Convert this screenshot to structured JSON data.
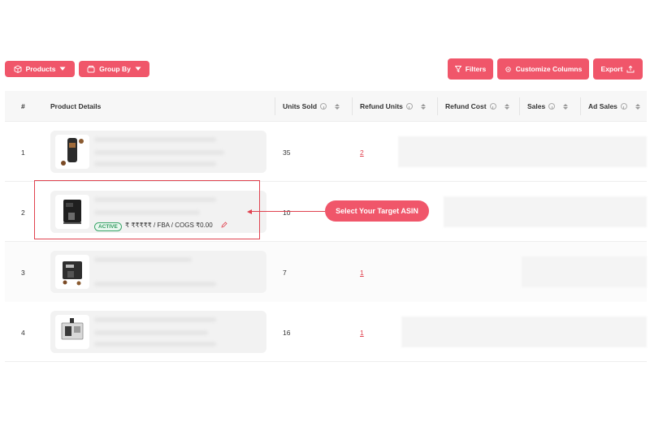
{
  "toolbar": {
    "products_label": "Products",
    "groupby_label": "Group By",
    "filters_label": "Filters",
    "customize_label": "Customize Columns",
    "export_label": "Export"
  },
  "table": {
    "headers": [
      "#",
      "Product Details",
      "Units Sold",
      "Refund Units",
      "Refund Cost",
      "Sales",
      "Ad Sales"
    ],
    "rows": [
      {
        "index": "1",
        "units_sold": "35",
        "refund_units": "2"
      },
      {
        "index": "2",
        "units_sold": "10",
        "refund_units": "",
        "status": "ACTIVE",
        "meta": "₹ ₹₹₹₹₹ / FBA / COGS ₹0.00"
      },
      {
        "index": "3",
        "units_sold": "7",
        "refund_units": "1"
      },
      {
        "index": "4",
        "units_sold": "16",
        "refund_units": "1"
      }
    ]
  },
  "callout": {
    "label": "Select Your Target ASIN"
  },
  "colors": {
    "accent": "#f0566a",
    "highlight": "#e0424f",
    "active": "#2f9a5e"
  },
  "icons": [
    "box-icon",
    "layers-icon",
    "caret-down-icon",
    "filter-icon",
    "gear-icon",
    "upload-icon",
    "info-icon",
    "sort-icon",
    "pencil-icon"
  ]
}
